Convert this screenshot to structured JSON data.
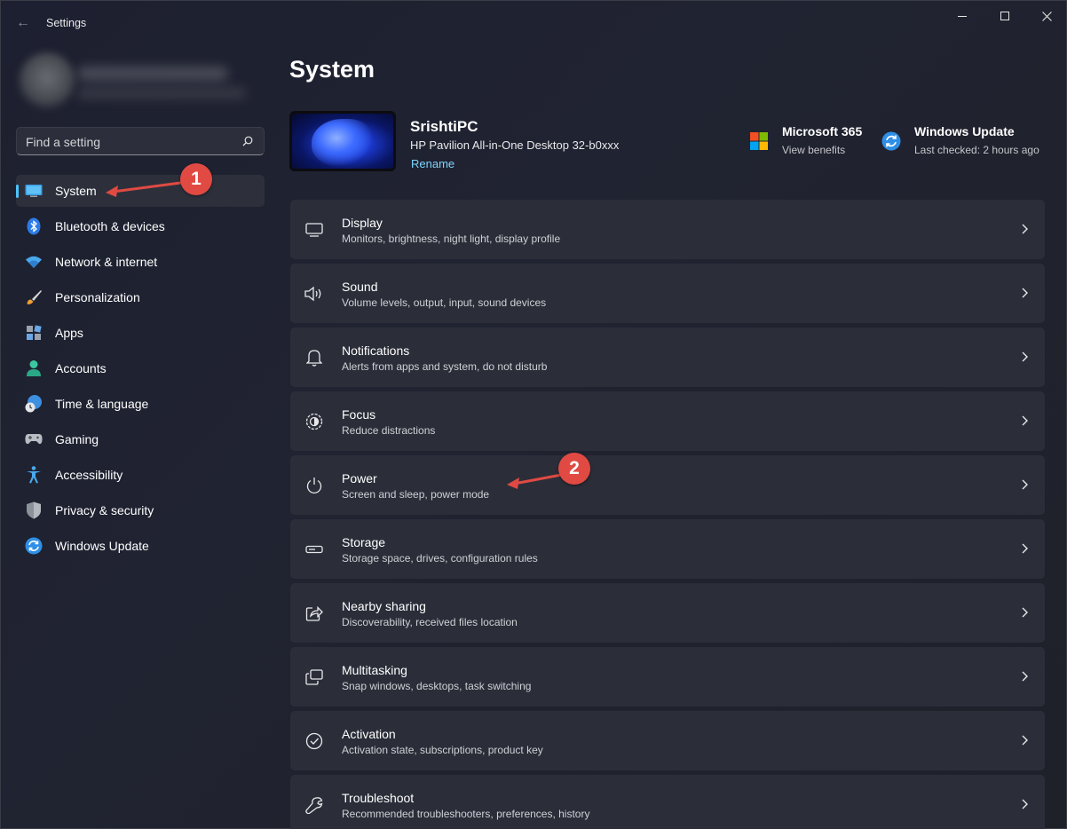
{
  "window": {
    "title": "Settings",
    "controls": {
      "minimize": "minimize",
      "maximize": "maximize",
      "close": "close"
    }
  },
  "search": {
    "placeholder": "Find a setting",
    "value": ""
  },
  "sidebar": {
    "items": [
      {
        "label": "System",
        "icon": "system-display-icon",
        "active": true
      },
      {
        "label": "Bluetooth & devices",
        "icon": "bluetooth-icon"
      },
      {
        "label": "Network & internet",
        "icon": "wifi-icon"
      },
      {
        "label": "Personalization",
        "icon": "brush-icon"
      },
      {
        "label": "Apps",
        "icon": "apps-icon"
      },
      {
        "label": "Accounts",
        "icon": "account-icon"
      },
      {
        "label": "Time & language",
        "icon": "globe-clock-icon"
      },
      {
        "label": "Gaming",
        "icon": "gamepad-icon"
      },
      {
        "label": "Accessibility",
        "icon": "accessibility-icon"
      },
      {
        "label": "Privacy & security",
        "icon": "shield-icon"
      },
      {
        "label": "Windows Update",
        "icon": "windows-update-icon"
      }
    ]
  },
  "main": {
    "title": "System",
    "device": {
      "name": "SrishtiPC",
      "model": "HP Pavilion All-in-One Desktop 32-b0xxx",
      "rename": "Rename"
    },
    "quick_links": [
      {
        "title": "Microsoft 365",
        "subtitle": "View benefits",
        "icon": "microsoft-logo-icon"
      },
      {
        "title": "Windows Update",
        "subtitle": "Last checked: 2 hours ago",
        "icon": "windows-update-icon"
      }
    ],
    "cards": [
      {
        "title": "Display",
        "subtitle": "Monitors, brightness, night light, display profile",
        "icon": "monitor-icon"
      },
      {
        "title": "Sound",
        "subtitle": "Volume levels, output, input, sound devices",
        "icon": "speaker-icon"
      },
      {
        "title": "Notifications",
        "subtitle": "Alerts from apps and system, do not disturb",
        "icon": "bell-icon"
      },
      {
        "title": "Focus",
        "subtitle": "Reduce distractions",
        "icon": "focus-icon"
      },
      {
        "title": "Power",
        "subtitle": "Screen and sleep, power mode",
        "icon": "power-icon"
      },
      {
        "title": "Storage",
        "subtitle": "Storage space, drives, configuration rules",
        "icon": "storage-drive-icon"
      },
      {
        "title": "Nearby sharing",
        "subtitle": "Discoverability, received files location",
        "icon": "share-icon"
      },
      {
        "title": "Multitasking",
        "subtitle": "Snap windows, desktops, task switching",
        "icon": "multitasking-icon"
      },
      {
        "title": "Activation",
        "subtitle": "Activation state, subscriptions, product key",
        "icon": "check-circle-icon"
      },
      {
        "title": "Troubleshoot",
        "subtitle": "Recommended troubleshooters, preferences, history",
        "icon": "wrench-icon"
      }
    ]
  },
  "annotations": [
    {
      "number": "1",
      "points_to": "System"
    },
    {
      "number": "2",
      "points_to": "Power"
    }
  ],
  "colors": {
    "background": "#1f2230",
    "card": "#2b2e39",
    "accent": "#4cc2ff",
    "link": "#7dd3fc",
    "annotation": "#e04a43"
  }
}
